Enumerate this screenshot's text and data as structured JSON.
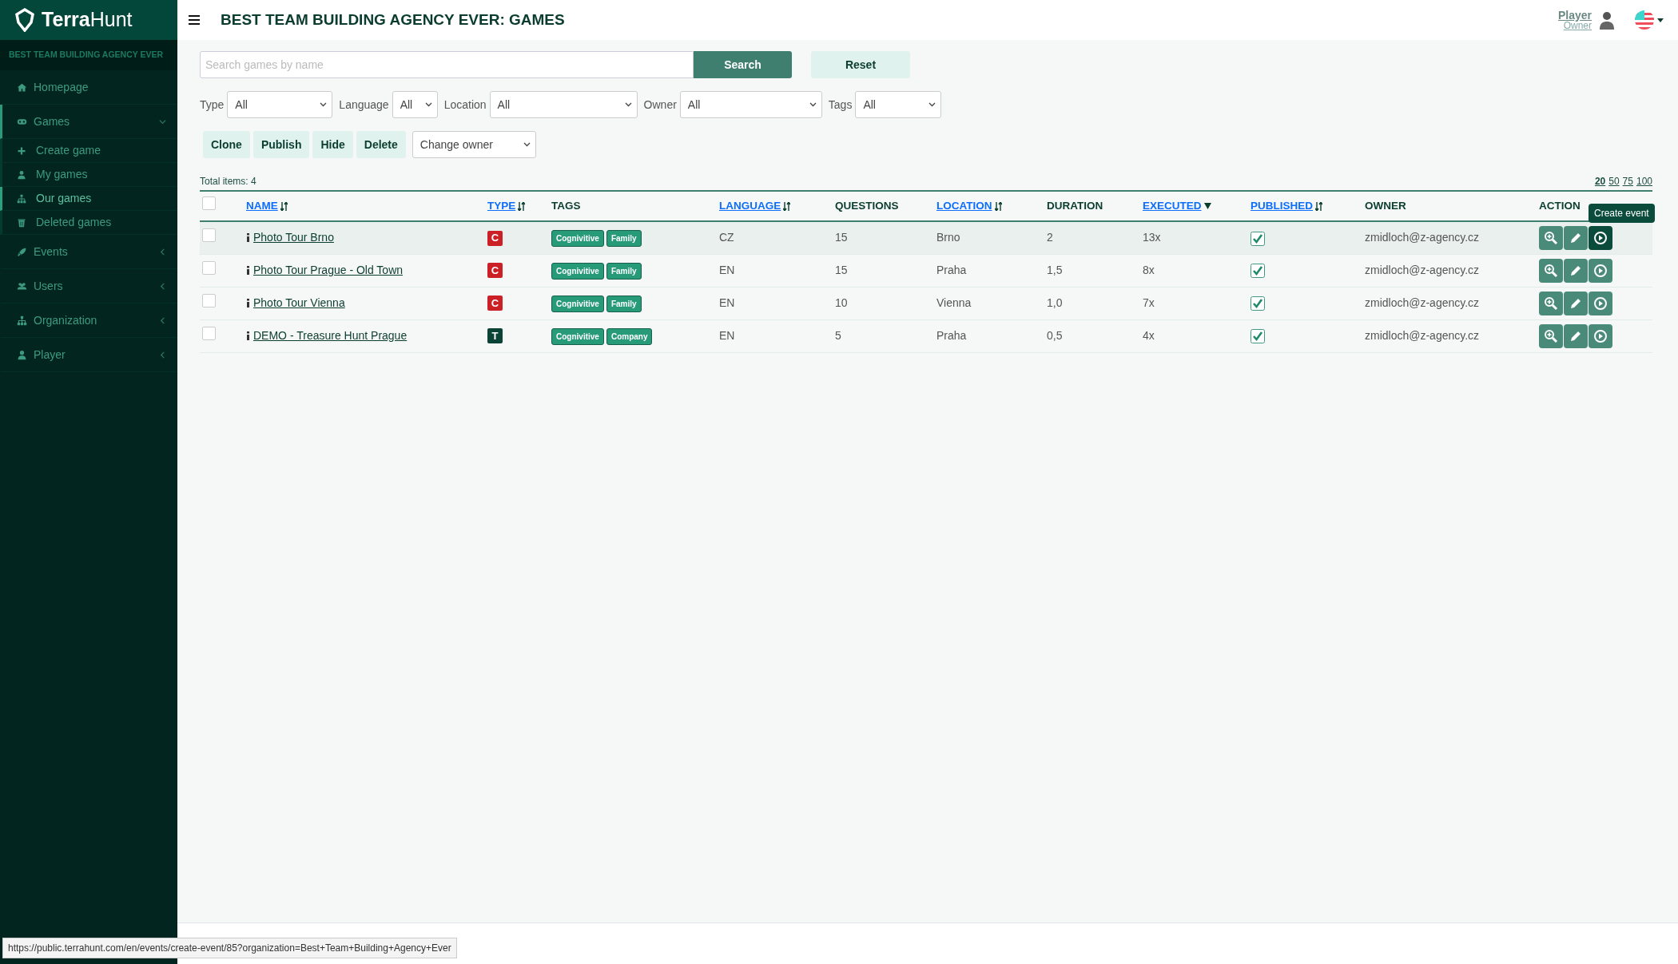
{
  "sidebar": {
    "brand": "**Terra**Hunt",
    "organization": "BEST TEAM BUILDING AGENCY EVER",
    "items": [
      {
        "label": "Homepage"
      },
      {
        "label": "Games",
        "expanded": true,
        "children": [
          {
            "label": "Create game",
            "selected": false
          },
          {
            "label": "My games",
            "selected": false
          },
          {
            "label": "Our games",
            "selected": true
          },
          {
            "label": "Deleted games",
            "selected": false
          }
        ]
      },
      {
        "label": "Events",
        "expanded": false
      },
      {
        "label": "Users",
        "expanded": false
      },
      {
        "label": "Organization",
        "expanded": false
      },
      {
        "label": "Player",
        "expanded": false
      }
    ]
  },
  "header": {
    "title": "BEST TEAM BUILDING AGENCY EVER: GAMES",
    "user": {
      "name": "Player",
      "role": "Owner"
    }
  },
  "search": {
    "placeholder": "Search games by name",
    "search_button": "Search",
    "reset_button": "Reset"
  },
  "filters": [
    {
      "label": "Type",
      "value": "All"
    },
    {
      "label": "Language",
      "value": "All"
    },
    {
      "label": "Location",
      "value": "All"
    },
    {
      "label": "Owner",
      "value": "All"
    },
    {
      "label": "Tags",
      "value": "All"
    }
  ],
  "bulk_actions": [
    "Clone",
    "Publish",
    "Hide",
    "Delete"
  ],
  "owner_select": "Change owner",
  "total_items": "Total items: 4",
  "page_sizes": [
    {
      "label": "20",
      "selected": true
    },
    {
      "label": "50",
      "selected": false
    },
    {
      "label": "75",
      "selected": false
    },
    {
      "label": "100",
      "selected": false
    }
  ],
  "table": {
    "all_checked": false,
    "columns": [
      {
        "label": "NAME",
        "sortable": true,
        "sorted_desc": false
      },
      {
        "label": "TYPE",
        "sortable": true,
        "sorted_desc": false
      },
      {
        "label": "TAGS",
        "sortable": false
      },
      {
        "label": "LANGUAGE",
        "sortable": true,
        "sorted_desc": false
      },
      {
        "label": "QUESTIONS",
        "sortable": false
      },
      {
        "label": "LOCATION",
        "sortable": true,
        "sorted_desc": false
      },
      {
        "label": "DURATION",
        "sortable": false
      },
      {
        "label": "EXECUTED",
        "sortable": true,
        "sorted_desc": true
      },
      {
        "label": "PUBLISHED",
        "sortable": true,
        "sorted_desc": false
      },
      {
        "label": "OWNER",
        "sortable": false
      },
      {
        "label": "ACTION",
        "sortable": false
      }
    ],
    "rows": [
      {
        "checked": false,
        "hovered": true,
        "name": "Photo Tour Brno",
        "type": "C",
        "color": "#cc2027",
        "tags": [
          "Cognivitive",
          "Family"
        ],
        "language": "CZ",
        "questions": "15",
        "location": "Brno",
        "duration": "2",
        "executed": "13x",
        "published": true,
        "owner": "zmidloch@z-agency.cz",
        "tooltip": "Create event"
      },
      {
        "checked": false,
        "hovered": false,
        "name": "Photo Tour Prague - Old Town",
        "type": "C",
        "color": "#cc2027",
        "tags": [
          "Cognivitive",
          "Family"
        ],
        "language": "EN",
        "questions": "15",
        "location": "Praha",
        "duration": "1,5",
        "executed": "8x",
        "published": true,
        "owner": "zmidloch@z-agency.cz"
      },
      {
        "checked": false,
        "hovered": false,
        "name": "Photo Tour Vienna",
        "type": "C",
        "color": "#cc2027",
        "tags": [
          "Cognivitive",
          "Family"
        ],
        "language": "EN",
        "questions": "10",
        "location": "Vienna",
        "duration": "1,0",
        "executed": "7x",
        "published": true,
        "owner": "zmidloch@z-agency.cz"
      },
      {
        "checked": false,
        "hovered": false,
        "name": "DEMO - Treasure Hunt Prague",
        "type": "T",
        "color": "#0b4436",
        "tags": [
          "Cognivitive",
          "Company"
        ],
        "language": "EN",
        "questions": "5",
        "location": "Praha",
        "duration": "0,5",
        "executed": "4x",
        "published": true,
        "owner": "zmidloch@z-agency.cz"
      }
    ]
  },
  "status_url": "https://public.terrahunt.com/en/events/create-event/85?organization=Best+Team+Building+Agency+Ever"
}
